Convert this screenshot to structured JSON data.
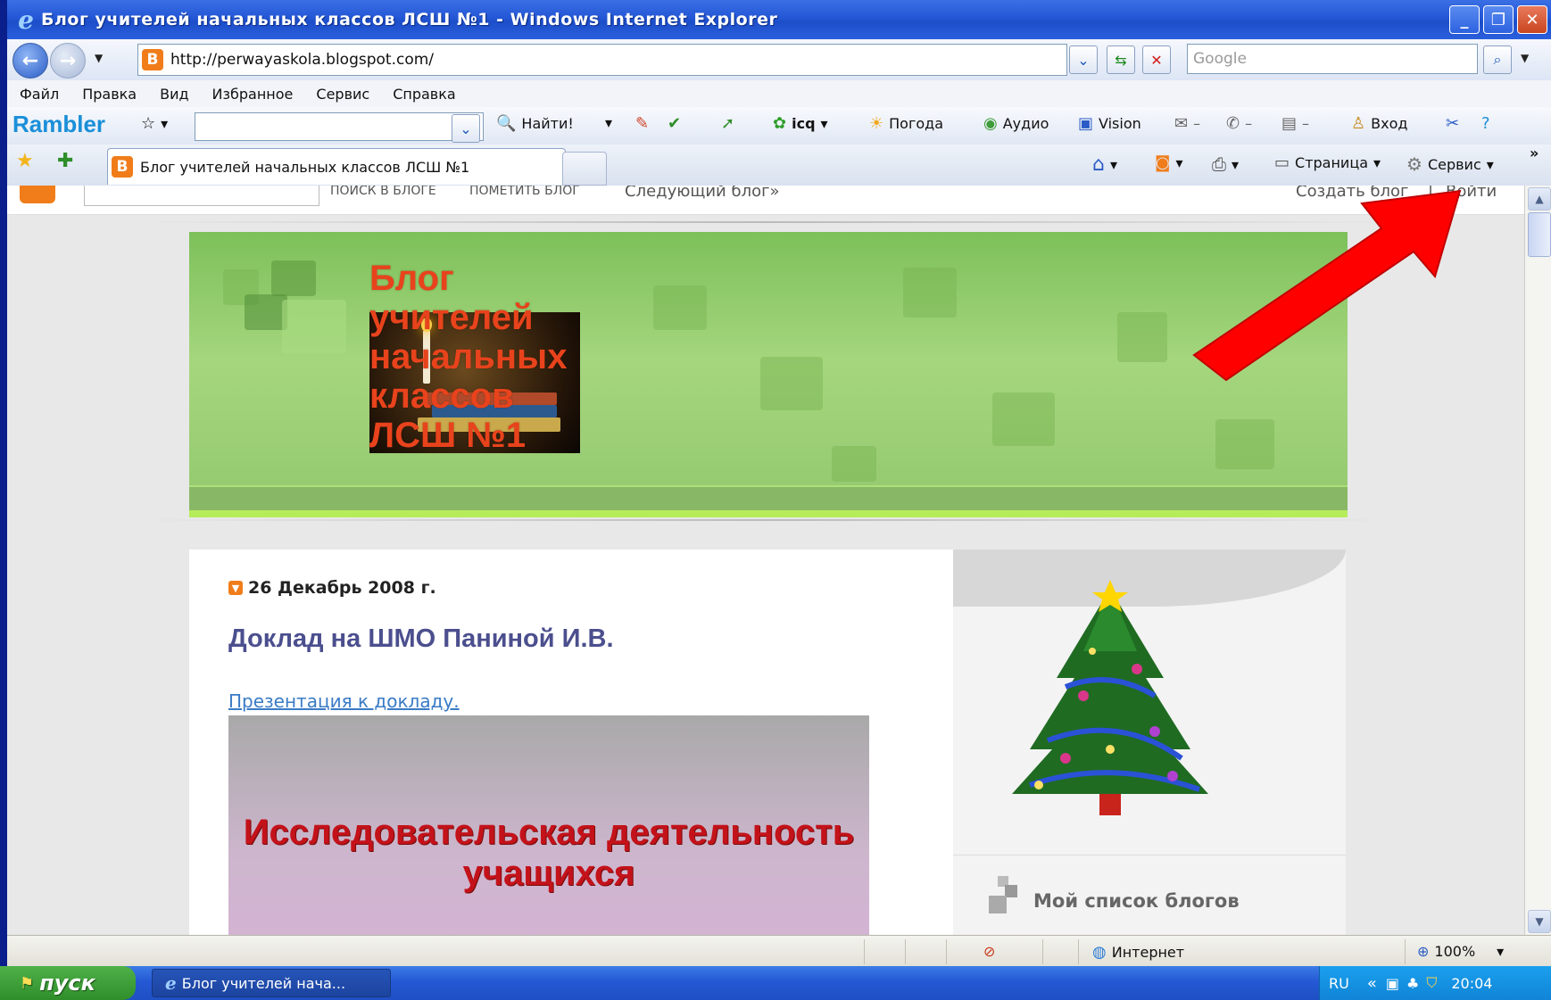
{
  "window": {
    "title": "Блог учителей начальных классов ЛСШ №1 - Windows Internet Explorer",
    "controls": [
      "_",
      "❐",
      "✕"
    ]
  },
  "address": {
    "url": "http://perwayaskola.blogspot.com/",
    "search_placeholder": "Google"
  },
  "menu": [
    "Файл",
    "Правка",
    "Вид",
    "Избранное",
    "Сервис",
    "Справка"
  ],
  "rambler": {
    "logo": "Rambler",
    "find_label": "Найти!",
    "icq_label": "icq",
    "weather_label": "Погода",
    "audio_label": "Аудио",
    "vision_label": "Vision",
    "login_label": "Вход"
  },
  "tabs": {
    "active_tab": "Блог учителей начальных классов ЛСШ №1",
    "page_label": "Страница",
    "tools_label": "Сервис",
    "overflow": "»"
  },
  "blogger_navbar": {
    "search_blog": "ПОИСК В БЛОГЕ",
    "flag_blog": "ПОМЕТИТЬ БЛОГ",
    "next_blog": "Следующий блог»",
    "create_blog": "Создать блог",
    "separator": "|",
    "sign_in": "Войти"
  },
  "blog": {
    "title": "Блог\nучителей\nначальных\nклассов\nЛСШ №1",
    "post_date": "26 Декабрь 2008 г.",
    "post_title": "Доклад на ШМО Паниной И.В.",
    "post_link": "Презентация к докладу.",
    "slide_text": "Исследовательская деятельность учащихся",
    "sidebar_title": "Мой список блогов"
  },
  "status": {
    "zone": "Интернет",
    "zoom": "100%"
  },
  "taskbar": {
    "start": "пуск",
    "task": "Блог учителей нача...",
    "lang": "RU",
    "clock": "20:04"
  },
  "colors": {
    "arrow": "#ff0000",
    "blog_title": "#e8431c",
    "header_green": "#93c86e"
  }
}
